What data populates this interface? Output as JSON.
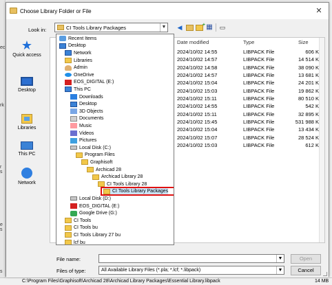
{
  "dialog": {
    "title": "Choose Library Folder or File",
    "close_glyph": "✕"
  },
  "lookin": {
    "label": "Look in:",
    "value": "CI Tools Library Packages"
  },
  "places": [
    {
      "label": "Quick access",
      "icon": "quick-access-icon"
    },
    {
      "label": "Desktop",
      "icon": "desktop-icon"
    },
    {
      "label": "Libraries",
      "icon": "libraries-icon"
    },
    {
      "label": "This PC",
      "icon": "this-pc-icon"
    },
    {
      "label": "Network",
      "icon": "network-icon"
    }
  ],
  "columns": {
    "date": "Date modified",
    "type": "Type",
    "size": "Size"
  },
  "files": [
    {
      "date": "2024/10/02 14:55",
      "type": "LIBPACK File",
      "size": "606 KB"
    },
    {
      "date": "2024/10/02 14:57",
      "type": "LIBPACK File",
      "size": "14 514 KB"
    },
    {
      "date": "2024/10/02 14:58",
      "type": "LIBPACK File",
      "size": "38 090 KB"
    },
    {
      "date": "2024/10/02 14:57",
      "type": "LIBPACK File",
      "size": "13 681 KB"
    },
    {
      "date": "2024/10/02 15:04",
      "type": "LIBPACK File",
      "size": "24 201 KB"
    },
    {
      "date": "2024/10/02 15:03",
      "type": "LIBPACK File",
      "size": "19 862 KB"
    },
    {
      "date": "2024/10/02 15:11",
      "type": "LIBPACK File",
      "size": "80 510 KB"
    },
    {
      "date": "2024/10/02 14:55",
      "type": "LIBPACK File",
      "size": "542 KB"
    },
    {
      "date": "2024/10/02 15:11",
      "type": "LIBPACK File",
      "size": "32 895 KB"
    },
    {
      "date": "2024/10/02 15:45",
      "type": "LIBPACK File",
      "size": "531 988 KB"
    },
    {
      "date": "2024/10/02 15:04",
      "type": "LIBPACK File",
      "size": "13 434 KB"
    },
    {
      "date": "2024/10/02 15:07",
      "type": "LIBPACK File",
      "size": "28 524 KB"
    },
    {
      "date": "2024/10/02 15:03",
      "type": "LIBPACK File",
      "size": "612 KB"
    }
  ],
  "dropdown_items": [
    {
      "label": "Recent Items",
      "icon": "recent"
    },
    {
      "label": "Desktop",
      "icon": "blue"
    },
    {
      "label": "Network",
      "icon": "blue"
    },
    {
      "label": "Libraries",
      "icon": "folder"
    },
    {
      "label": "Admin",
      "icon": "user"
    },
    {
      "label": "OneDrive",
      "icon": "cloud"
    },
    {
      "label": "EOS_DIGITAL (E:)",
      "icon": "red"
    },
    {
      "label": "This PC",
      "icon": "blue"
    },
    {
      "label": "Downloads",
      "icon": "dl"
    },
    {
      "label": "Desktop",
      "icon": "blue"
    },
    {
      "label": "3D Objects",
      "icon": "obj"
    },
    {
      "label": "Documents",
      "icon": "docs"
    },
    {
      "label": "Music",
      "icon": "music"
    },
    {
      "label": "Videos",
      "icon": "video"
    },
    {
      "label": "Pictures",
      "icon": "pict"
    },
    {
      "label": "Local Disk (C:)",
      "icon": "drive"
    },
    {
      "label": "Program Files",
      "icon": "folder"
    },
    {
      "label": "Graphisoft",
      "icon": "folder"
    },
    {
      "label": "Archicad 28",
      "icon": "folder"
    },
    {
      "label": "Archicad Library 28",
      "icon": "folder"
    },
    {
      "label": "CI Tools Library 28",
      "icon": "folder"
    },
    {
      "label": "CI Tools Library Packages",
      "icon": "folder"
    },
    {
      "label": "Local Disk (D:)",
      "icon": "drive"
    },
    {
      "label": "EOS_DIGITAL (E:)",
      "icon": "red"
    },
    {
      "label": "Google Drive (G:)",
      "icon": "gdrive"
    },
    {
      "label": "CI Tools",
      "icon": "folder"
    },
    {
      "label": "CI Tools bu",
      "icon": "folder"
    },
    {
      "label": "CI Tools Library 27 bu",
      "icon": "folder"
    },
    {
      "label": "lcf bu",
      "icon": "folder"
    }
  ],
  "filename": {
    "label": "File name:",
    "value": ""
  },
  "filetype": {
    "label": "Files of type:",
    "value": "All Available Library Files (*.pla; *.lcf; *.libpack)"
  },
  "buttons": {
    "open": "Open",
    "cancel": "Cancel"
  },
  "background": {
    "left_texts": [
      "ec",
      "rk",
      "r s",
      "e s",
      "s"
    ],
    "status_path": "C:\\Program Files\\Graphisoft\\Archicad 28\\Archicad Library Packages\\Essential Library.libpack",
    "status_size": "14 MB"
  }
}
